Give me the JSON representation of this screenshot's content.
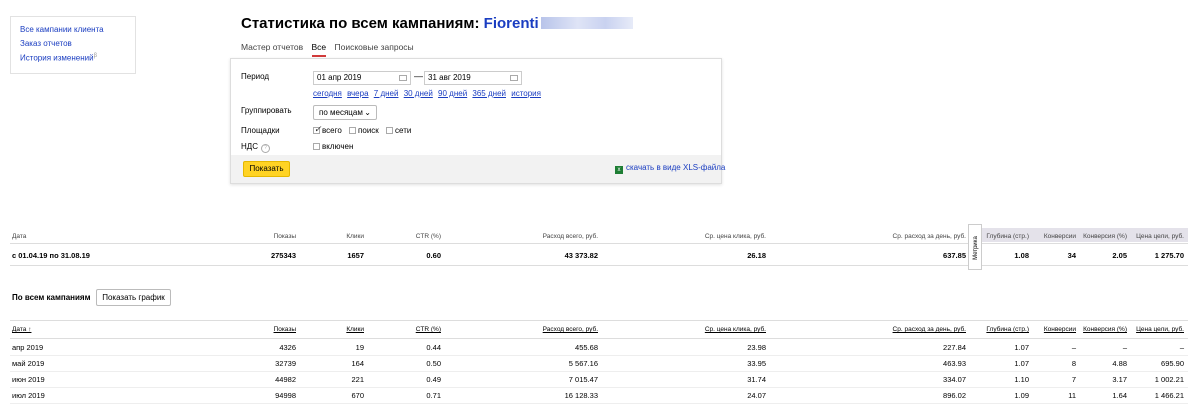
{
  "nav": {
    "links": [
      "Все кампании клиента",
      "Заказ отчетов",
      "История изменений"
    ],
    "history_sup": "β"
  },
  "title": {
    "prefix": "Статистика по всем кампаниям:",
    "client": "Fiorenti"
  },
  "tabs": [
    "Мастер отчетов",
    "Все",
    "Поисковые запросы"
  ],
  "form": {
    "period_label": "Период",
    "date_from": "01 апр 2019",
    "date_to": "31 авг 2019",
    "dash": "—",
    "quick": [
      "сегодня",
      "вчера",
      "7 дней",
      "30 дней",
      "90 дней",
      "365 дней",
      "история"
    ],
    "group_label": "Группировать",
    "group_value": "по месяцам",
    "platforms_label": "Площадки",
    "platforms": [
      "всего",
      "поиск",
      "сети"
    ],
    "vat_label": "НДС",
    "vat_option": "включен",
    "submit": "Показать",
    "xls": "скачать в виде XLS-файла"
  },
  "metrika_tab": "Метрика",
  "summary": {
    "headers": [
      "Дата",
      "Показы",
      "Клики",
      "CTR (%)",
      "Расход всего, руб.",
      "Ср. цена клика, руб.",
      "Ср. расход за день, руб.",
      "Глубина (стр.)",
      "Конверсии",
      "Конверсия (%)",
      "Цена цели, руб."
    ],
    "row": [
      "с 01.04.19 по 31.08.19",
      "275343",
      "1657",
      "0.60",
      "43 373.82",
      "26.18",
      "637.85",
      "1.08",
      "34",
      "2.05",
      "1 275.70"
    ]
  },
  "campaigns": {
    "title": "По всем кампаниям",
    "chart_button": "Показать график",
    "headers": [
      "Дата ↑",
      "Показы",
      "Клики",
      "CTR (%)",
      "Расход всего, руб.",
      "Ср. цена клика, руб.",
      "Ср. расход за день, руб.",
      "Глубина (стр.)",
      "Конверсии",
      "Конверсия (%)",
      "Цена цели, руб."
    ],
    "rows": [
      [
        "апр 2019",
        "4326",
        "19",
        "0.44",
        "455.68",
        "23.98",
        "227.84",
        "1.07",
        "–",
        "–",
        "–"
      ],
      [
        "май 2019",
        "32739",
        "164",
        "0.50",
        "5 567.16",
        "33.95",
        "463.93",
        "1.07",
        "8",
        "4.88",
        "695.90"
      ],
      [
        "июн 2019",
        "44982",
        "221",
        "0.49",
        "7 015.47",
        "31.74",
        "334.07",
        "1.10",
        "7",
        "3.17",
        "1 002.21"
      ],
      [
        "июл 2019",
        "94998",
        "670",
        "0.71",
        "16 128.33",
        "24.07",
        "896.02",
        "1.09",
        "11",
        "1.64",
        "1 466.21"
      ]
    ]
  }
}
